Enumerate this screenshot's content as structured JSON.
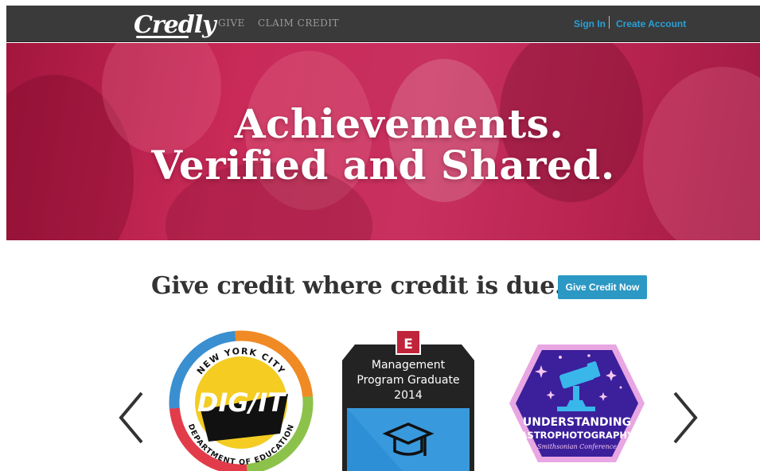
{
  "nav": {
    "logo": "Credly",
    "links": [
      "GIVE",
      "CLAIM CREDIT"
    ],
    "sign_in": "Sign In",
    "create_account": "Create Account"
  },
  "hero": {
    "line1": "Achievements.",
    "line2": "Verified and Shared."
  },
  "cta": {
    "tagline": "Give credit where credit is due.",
    "button": "Give Credit Now"
  },
  "badges": [
    {
      "top_text": "NEW YORK CITY",
      "center": "DIG/IT",
      "bottom_text": "DEPARTMENT OF EDUCATION"
    },
    {
      "letter": "E",
      "line1": "Management",
      "line2": "Program Graduate",
      "line3": "2014"
    },
    {
      "line1": "UNDERSTANDING",
      "line2": "ASTROPHOTOGRAPHY",
      "line3": "Smithsonian Conference"
    }
  ],
  "colors": {
    "nav_bg": "#3a3a3a",
    "accent": "#2aa0d4",
    "hero": "#c92a58",
    "button": "#2c98c4"
  },
  "icons": [
    "chevron-left-icon",
    "chevron-right-icon",
    "graduation-cap-icon",
    "telescope-icon"
  ]
}
